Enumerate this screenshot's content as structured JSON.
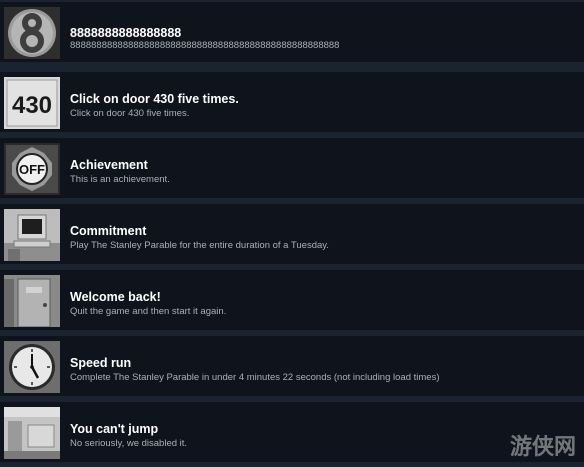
{
  "achievements": [
    {
      "title": "8888888888888888",
      "description": "888888888888888888888888888888888888888888888888888",
      "icon": "eight-ball-icon"
    },
    {
      "title": "Click on door 430 five times.",
      "description": "Click on door 430 five times.",
      "icon": "door-number-430-icon"
    },
    {
      "title": "Achievement",
      "description": "This is an achievement.",
      "icon": "off-button-icon"
    },
    {
      "title": "Commitment",
      "description": "Play The Stanley Parable for the entire duration of a Tuesday.",
      "icon": "computer-monitor-icon"
    },
    {
      "title": "Welcome back!",
      "description": "Quit the game and then start it again.",
      "icon": "office-door-icon"
    },
    {
      "title": "Speed run",
      "description": "Complete The Stanley Parable in under 4 minutes 22 seconds (not including load times)",
      "icon": "wall-clock-icon"
    },
    {
      "title": "You can't jump",
      "description": "No seriously, we disabled it.",
      "icon": "office-room-icon"
    }
  ],
  "icon_texts": {
    "number": "430",
    "off": "OFF"
  },
  "watermark": "游侠网"
}
